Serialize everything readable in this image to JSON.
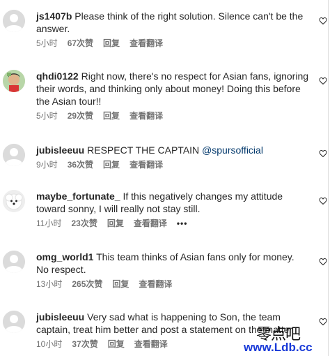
{
  "comments": [
    {
      "username": "js1407b",
      "text": "Please think of the right solution. Silence can't be the answer.",
      "time": "5小时",
      "likes": "67次赞",
      "reply": "回复",
      "translate": "查看翻译",
      "avatar": "default-avatar"
    },
    {
      "username": "qhdi0122",
      "text": "Right now, there's no respect for Asian fans, ignoring their words, and thinking only about money! Doing this before the Asian tour!!",
      "time": "5小时",
      "likes": "29次赞",
      "reply": "回复",
      "translate": "查看翻译",
      "avatar": "photo-avatar"
    },
    {
      "username": "jubisleeuu",
      "text": "RESPECT THE CAPTAIN",
      "mention": "@spursofficial",
      "time": "9小时",
      "likes": "36次赞",
      "reply": "回复",
      "translate": "查看翻译",
      "avatar": "default-avatar"
    },
    {
      "username": "maybe_fortunate_",
      "text": "If this negatively changes my attitude toward sonny, I will really not stay still.",
      "time": "11小时",
      "likes": "23次赞",
      "reply": "回复",
      "translate": "查看翻译",
      "more": "•••",
      "avatar": "photo-avatar"
    },
    {
      "username": "omg_world1",
      "text": "This team thinks of Asian fans only for money. No respect.",
      "time": "13小时",
      "likes": "265次赞",
      "reply": "回复",
      "translate": "查看翻译",
      "avatar": "default-avatar"
    },
    {
      "username": "jubisleeuu",
      "text": "Very sad what is happening to Son, the team captain, treat him better and post a statement on the matter",
      "time": "10小时",
      "likes": "37次赞",
      "reply": "回复",
      "translate": "查看翻译",
      "avatar": "default-avatar"
    }
  ],
  "watermark": {
    "line1": "零点吧",
    "line2": "www.Ldb.cc"
  },
  "colors": {
    "text": "#262626",
    "meta": "#737373",
    "mention": "#00376b",
    "watermark_url": "#1a3bd8"
  }
}
